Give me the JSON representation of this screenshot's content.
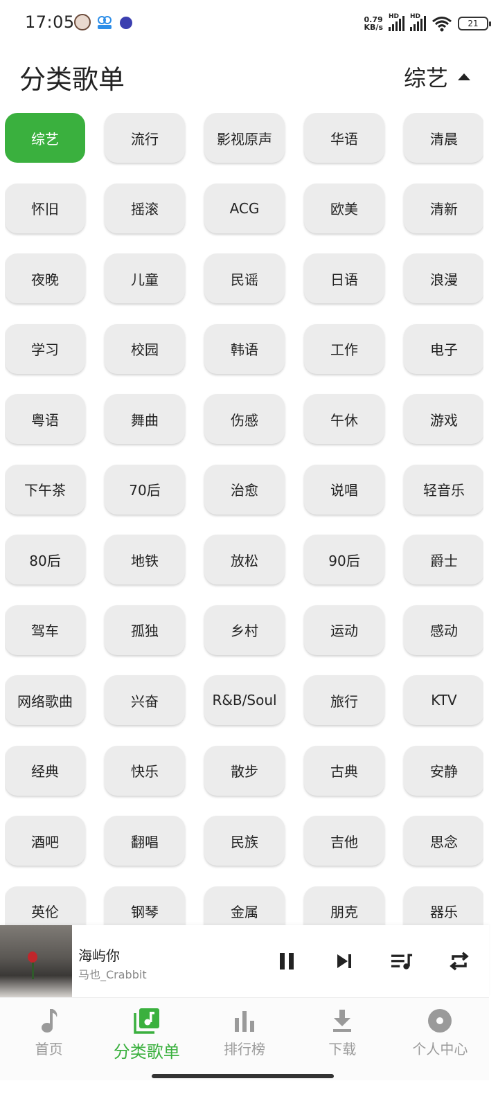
{
  "status_bar": {
    "time": "17:05",
    "net_speed_value": "0.79",
    "net_speed_unit": "KB/s",
    "signal_label": "HD",
    "battery": "21",
    "icons": [
      "avatar-notification-icon",
      "app-notification-icon",
      "app-notification-icon",
      "signal-icon",
      "wifi-icon",
      "battery-icon"
    ]
  },
  "header": {
    "title": "分类歌单",
    "current_category": "综艺"
  },
  "categories": [
    "综艺",
    "流行",
    "影视原声",
    "华语",
    "清晨",
    "怀旧",
    "摇滚",
    "ACG",
    "欧美",
    "清新",
    "夜晚",
    "儿童",
    "民谣",
    "日语",
    "浪漫",
    "学习",
    "校园",
    "韩语",
    "工作",
    "电子",
    "粤语",
    "舞曲",
    "伤感",
    "午休",
    "游戏",
    "下午茶",
    "70后",
    "治愈",
    "说唱",
    "轻音乐",
    "80后",
    "地铁",
    "放松",
    "90后",
    "爵士",
    "驾车",
    "孤独",
    "乡村",
    "运动",
    "感动",
    "网络歌曲",
    "兴奋",
    "R&B/Soul",
    "旅行",
    "KTV",
    "经典",
    "快乐",
    "散步",
    "古典",
    "安静",
    "酒吧",
    "翻唱",
    "民族",
    "吉他",
    "思念",
    "英伦",
    "钢琴",
    "金属",
    "朋克",
    "器乐"
  ],
  "selected_category_index": 0,
  "player": {
    "title": "海屿你",
    "artist": "马也_Crabbit",
    "controls": [
      "pause-icon",
      "next-icon",
      "playlist-icon",
      "repeat-icon"
    ]
  },
  "nav": {
    "items": [
      {
        "label": "首页",
        "icon": "music-note-icon"
      },
      {
        "label": "分类歌单",
        "icon": "album-list-icon"
      },
      {
        "label": "排行榜",
        "icon": "bar-chart-icon"
      },
      {
        "label": "下载",
        "icon": "download-icon"
      },
      {
        "label": "个人中心",
        "icon": "disc-icon"
      }
    ],
    "active_index": 1
  },
  "colors": {
    "accent": "#3ab03e",
    "tag_bg": "#ececec",
    "inactive_nav": "#9a9a9a"
  }
}
